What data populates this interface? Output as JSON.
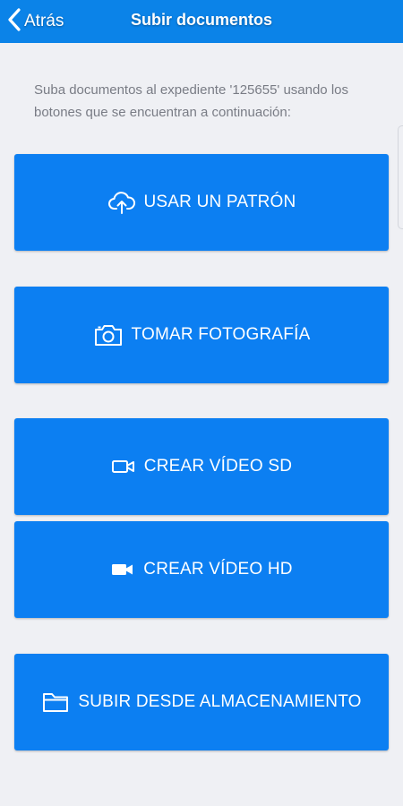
{
  "header": {
    "back_label": "Atrás",
    "title": "Subir documentos",
    "background": "#0b83e8"
  },
  "intro_text": "Suba documentos al expediente '125655' usando los botones que se encuentran a continuación:",
  "buttons": [
    {
      "label": "USAR UN PATRÓN",
      "icon": "cloud-upload-icon"
    },
    {
      "label": "TOMAR FOTOGRAFÍA",
      "icon": "camera-icon"
    },
    {
      "label": "CREAR VÍDEO SD",
      "icon": "video-outline-icon"
    },
    {
      "label": "CREAR VÍDEO HD",
      "icon": "video-filled-icon"
    },
    {
      "label": "SUBIR DESDE ALMACENAMIENTO",
      "icon": "folder-icon"
    }
  ],
  "colors": {
    "button": "#0c7ff2",
    "page_background": "#eff0f4",
    "intro_text": "#797c85"
  }
}
